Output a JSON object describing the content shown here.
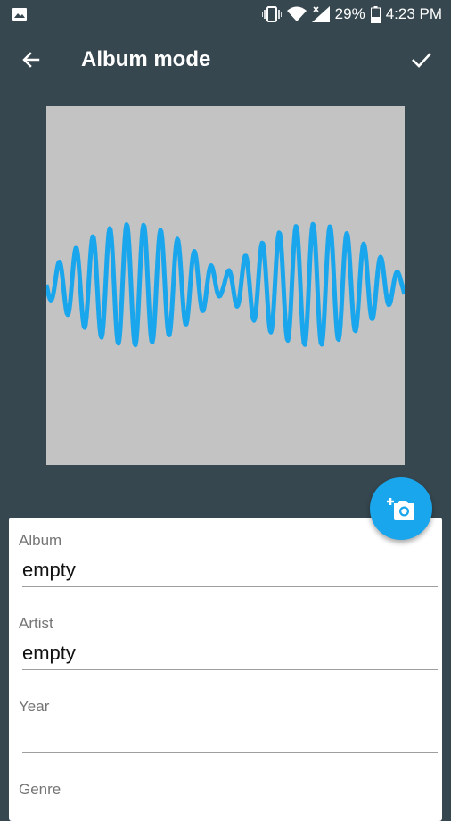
{
  "status_bar": {
    "battery_percent": "29%",
    "time": "4:23 PM"
  },
  "app_bar": {
    "title": "Album mode",
    "back_icon": "arrow-back-icon",
    "confirm_icon": "check-icon"
  },
  "album_art": {
    "background_color": "#c3c3c3",
    "waveform_color": "#1aa6ec"
  },
  "form": {
    "fields": [
      {
        "label": "Album",
        "value": "empty"
      },
      {
        "label": "Artist",
        "value": "empty"
      },
      {
        "label": "Year",
        "value": ""
      },
      {
        "label": "Genre",
        "value": ""
      }
    ]
  },
  "fab": {
    "icon": "add-photo-icon",
    "color": "#1aa6ec"
  },
  "colors": {
    "background": "#37474f",
    "card": "#ffffff"
  }
}
